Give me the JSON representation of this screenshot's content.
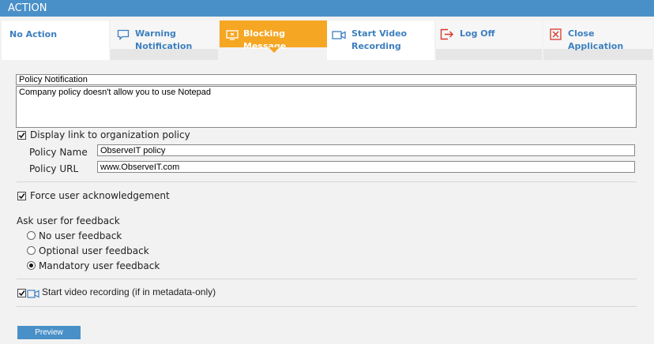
{
  "header": {
    "title": "ACTION"
  },
  "tabs": [
    {
      "label": "No Action",
      "icon": "none"
    },
    {
      "label_line1": "Warning",
      "label_line2": "Notification",
      "icon": "chat-bubble-icon"
    },
    {
      "label": "Blocking Message",
      "icon": "monitor-icon",
      "active": true
    },
    {
      "label_line1": "Start Video",
      "label_line2": "Recording",
      "icon": "video-camera-icon"
    },
    {
      "label": "Log Off",
      "icon": "logoff-icon"
    },
    {
      "label": "Close Application",
      "icon": "close-box-icon"
    }
  ],
  "form": {
    "title_value": "Policy Notification",
    "message_value": "Company policy doesn't allow you to use Notepad",
    "display_link_label": "Display link to organization policy",
    "display_link_checked": true,
    "policy_name_label": "Policy Name",
    "policy_name_value": "ObserveIT policy",
    "policy_url_label": "Policy URL",
    "policy_url_value": "www.ObserveIT.com",
    "force_ack_label": "Force user acknowledgement",
    "force_ack_checked": true,
    "feedback_heading": "Ask user for feedback",
    "feedback_options": [
      "No user feedback",
      "Optional user feedback",
      "Mandatory user feedback"
    ],
    "feedback_selected": "Mandatory user feedback",
    "video_label": "Start video recording (if in metadata-only)",
    "video_checked": true,
    "preview_label": "Preview"
  },
  "colors": {
    "header": "#4a90c8",
    "active_tab": "#f5a623",
    "tab_text": "#3d7fbf",
    "button": "#4a90c8",
    "red_icon": "#d9382d"
  }
}
